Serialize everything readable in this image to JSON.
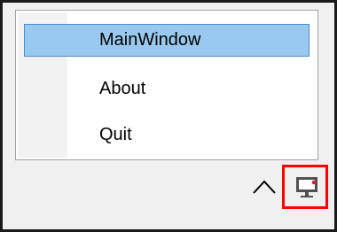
{
  "context_menu": {
    "items": [
      {
        "label": "MainWindow",
        "highlighted": true
      },
      {
        "label": "About",
        "highlighted": false
      },
      {
        "label": "Quit",
        "highlighted": false
      }
    ]
  },
  "taskbar": {
    "overflow_icon": "chevron-up-icon",
    "tray_icon": "monitor-icon",
    "highlight_color": "#ff0000"
  }
}
